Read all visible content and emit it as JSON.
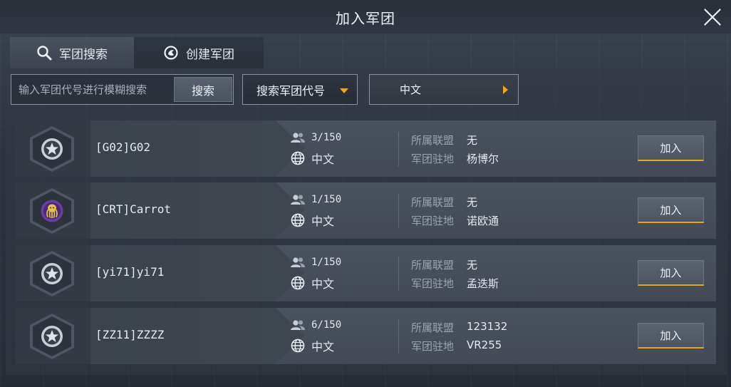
{
  "header": {
    "title": "加入军团"
  },
  "tabs": [
    {
      "label": "军团搜索",
      "icon": "search-icon",
      "active": true
    },
    {
      "label": "创建军团",
      "icon": "create-emblem-icon",
      "active": false
    }
  ],
  "search": {
    "placeholder": "输入军团代号进行模糊搜索",
    "button_label": "搜索"
  },
  "filter": {
    "selected": "搜索军团代号"
  },
  "language": {
    "selected": "中文"
  },
  "labels": {
    "alliance": "所属联盟",
    "location": "军团驻地",
    "join": "加入"
  },
  "legions": [
    {
      "name": "[G02]G02",
      "members": "3/150",
      "language": "中文",
      "alliance": "无",
      "location": "杨博尔",
      "emblem": "star-emblem-icon"
    },
    {
      "name": "[CRT]Carrot",
      "members": "1/150",
      "language": "中文",
      "alliance": "无",
      "location": "诺欧通",
      "emblem": "octopus-emblem-icon"
    },
    {
      "name": "[yi71]yi71",
      "members": "1/150",
      "language": "中文",
      "alliance": "无",
      "location": "孟迭斯",
      "emblem": "star-emblem-icon"
    },
    {
      "name": "[ZZ11]ZZZZ",
      "members": "6/150",
      "language": "中文",
      "alliance": "123132",
      "location": "VR255",
      "emblem": "star-emblem-icon"
    }
  ],
  "colors": {
    "accent": "#f2a624",
    "panel": "#434a55",
    "emblem_purple": "#6b3fa0",
    "emblem_gold": "#e5c04a"
  }
}
